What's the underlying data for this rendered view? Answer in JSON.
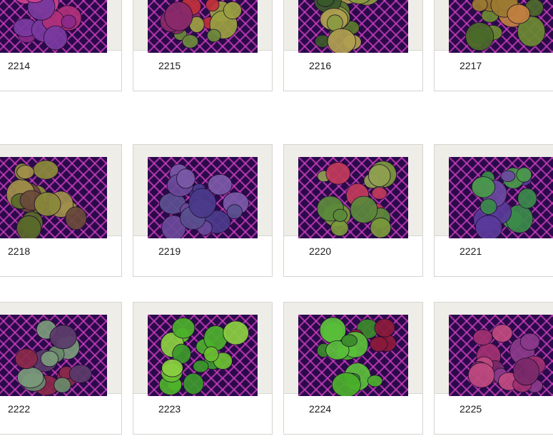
{
  "products": [
    {
      "label": "2214",
      "palette": [
        "#b0307a",
        "#8a2a8a",
        "#d04090",
        "#7a3aa0"
      ]
    },
    {
      "label": "2215",
      "palette": [
        "#c0303a",
        "#6a8a3a",
        "#8a2a6a",
        "#9aa040"
      ]
    },
    {
      "label": "2216",
      "palette": [
        "#5a7a2a",
        "#8a9a40",
        "#3a5a2a",
        "#b0a050"
      ]
    },
    {
      "label": "2217",
      "palette": [
        "#6a8a30",
        "#9a7a30",
        "#4a6a2a",
        "#c08040"
      ]
    },
    {
      "label": "2218",
      "palette": [
        "#5a6a2a",
        "#8a8a3a",
        "#6a4a3a",
        "#a0904a"
      ]
    },
    {
      "label": "2219",
      "palette": [
        "#6a4a9a",
        "#5a5090",
        "#7a5aa8",
        "#4a3a8a"
      ]
    },
    {
      "label": "2220",
      "palette": [
        "#7a9a3a",
        "#c03a5a",
        "#5a8a3a",
        "#90a050"
      ]
    },
    {
      "label": "2221",
      "palette": [
        "#5a3a9a",
        "#4a9a4a",
        "#6a4aa0",
        "#3a8a4a"
      ]
    },
    {
      "label": "2222",
      "palette": [
        "#6a8a6a",
        "#8a2a4a",
        "#7a9a7a",
        "#5a3a6a"
      ]
    },
    {
      "label": "2223",
      "palette": [
        "#4ab02a",
        "#6ac030",
        "#3a9a2a",
        "#8ad040"
      ]
    },
    {
      "label": "2224",
      "palette": [
        "#4ab02a",
        "#8a1a3a",
        "#5ac03a",
        "#3a8a2a"
      ]
    },
    {
      "label": "2225",
      "palette": [
        "#a03070",
        "#8a3a8a",
        "#c04a80",
        "#7a2a6a"
      ]
    }
  ],
  "colors": {
    "mat": "#eeede8",
    "border": "#d6d4ce",
    "label": "#1a1a1a",
    "photo_bg": "#2a0a4a",
    "grid_line": "#d040c0"
  }
}
